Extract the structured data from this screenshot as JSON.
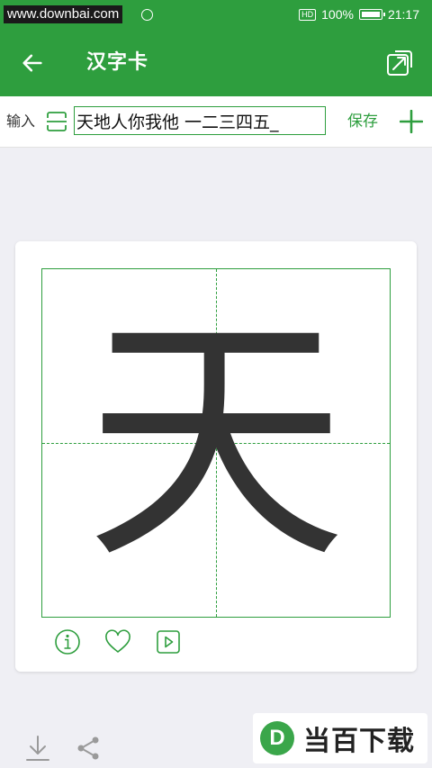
{
  "status_bar": {
    "watermark": "www.downbai.com",
    "hd_label": "HD",
    "battery_percent": "100%",
    "battery_level": 1.0,
    "time": "21:17"
  },
  "app_bar": {
    "title": "汉字卡",
    "back_icon": "arrow-left-icon",
    "expand_icon": "expand-icon"
  },
  "input_row": {
    "label": "输入",
    "scan_icon": "scan-icon",
    "value": "天地人你我他 一二三四五_",
    "save_label": "保存",
    "add_icon": "plus-icon"
  },
  "card": {
    "character": "天",
    "actions": [
      "info-icon",
      "heart-icon",
      "play-icon"
    ]
  },
  "bottom_toolbar": {
    "icons": [
      "download-icon",
      "share-icon"
    ]
  },
  "brand": {
    "logo_letter": "D",
    "name": "当百下载"
  },
  "colors": {
    "primary": "#2e9e3e",
    "background": "#efeff4",
    "character": "#333333"
  }
}
